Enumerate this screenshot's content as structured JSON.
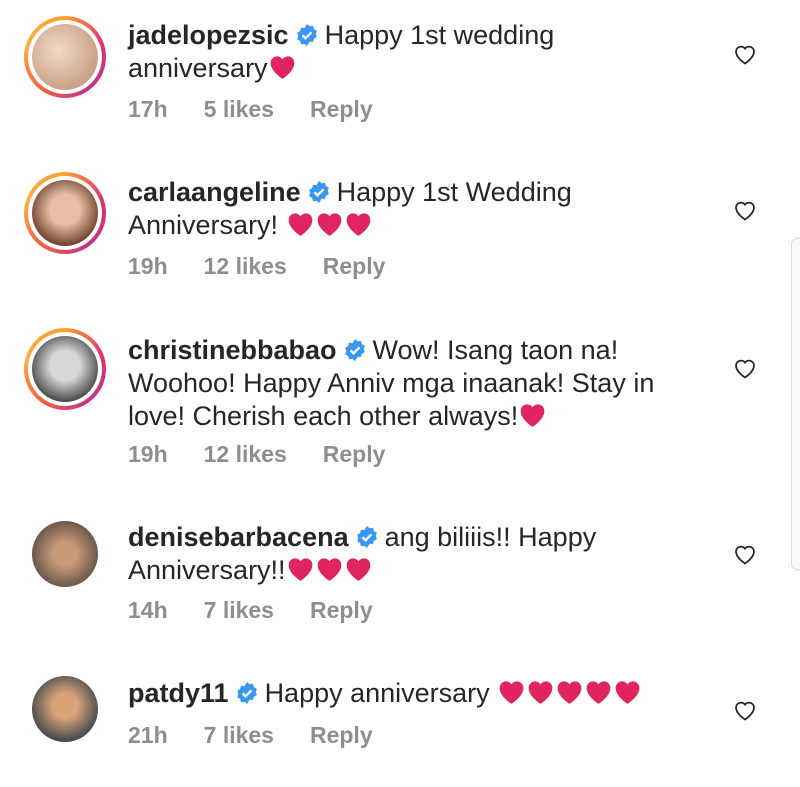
{
  "colors": {
    "verified": "#3897f0",
    "heart": "#e0245e",
    "meta": "#8e8e8e"
  },
  "comments": [
    {
      "username": "jadelopezsic",
      "text": "Happy 1st wedding anniversary",
      "hearts": 1,
      "time": "17h",
      "likes": "5 likes",
      "reply": "Reply",
      "story_ring": true
    },
    {
      "username": "carlaangeline",
      "text": "Happy 1st Wedding Anniversary! ",
      "hearts": 3,
      "time": "19h",
      "likes": "12 likes",
      "reply": "Reply",
      "story_ring": true
    },
    {
      "username": "christinebbabao",
      "text": "Wow! Isang taon na! Woohoo! Happy Anniv mga inaanak! Stay in love! Cherish each other always!",
      "hearts": 1,
      "time": "19h",
      "likes": "12 likes",
      "reply": "Reply",
      "story_ring": true
    },
    {
      "username": "denisebarbacena",
      "text": "ang biliiis!! Happy Anniversary!!",
      "hearts": 3,
      "time": "14h",
      "likes": "7 likes",
      "reply": "Reply",
      "story_ring": false
    },
    {
      "username": "patdy11",
      "text": "Happy anniversary ",
      "hearts": 5,
      "time": "21h",
      "likes": "7 likes",
      "reply": "Reply",
      "story_ring": false
    }
  ]
}
